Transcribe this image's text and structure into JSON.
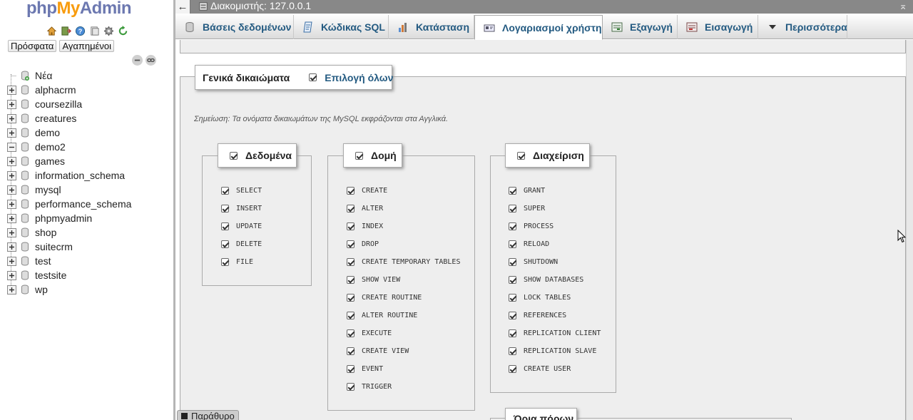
{
  "logo": {
    "php": "php",
    "my": "My",
    "admin": "Admin"
  },
  "nav": {
    "icons": [
      "home-icon",
      "exit-icon",
      "help-icon",
      "docs-icon",
      "settings-icon",
      "reload-icon"
    ],
    "tabs": [
      "Πρόσφατα",
      "Αγαπημένοι"
    ],
    "tree": [
      {
        "label": "Νέα",
        "type": "new"
      },
      {
        "label": "alphacrm",
        "type": "plus"
      },
      {
        "label": "coursezilla",
        "type": "plus"
      },
      {
        "label": "creatures",
        "type": "plus"
      },
      {
        "label": "demo",
        "type": "plus"
      },
      {
        "label": "demo2",
        "type": "minus"
      },
      {
        "label": "games",
        "type": "plus"
      },
      {
        "label": "information_schema",
        "type": "plus"
      },
      {
        "label": "mysql",
        "type": "plus"
      },
      {
        "label": "performance_schema",
        "type": "plus"
      },
      {
        "label": "phpmyadmin",
        "type": "plus"
      },
      {
        "label": "shop",
        "type": "plus"
      },
      {
        "label": "suitecrm",
        "type": "plus"
      },
      {
        "label": "test",
        "type": "plus"
      },
      {
        "label": "testsite",
        "type": "plus"
      },
      {
        "label": "wp",
        "type": "plus"
      }
    ]
  },
  "topbar": {
    "back": "←",
    "server": "Διακομιστής: 127.0.0.1",
    "collapse": "⌅"
  },
  "tabs": [
    {
      "label": "Βάσεις δεδομένων",
      "icon": "database-icon",
      "active": false
    },
    {
      "label": "Κώδικας SQL",
      "icon": "sql-icon",
      "active": false
    },
    {
      "label": "Κατάσταση",
      "icon": "status-icon",
      "active": false
    },
    {
      "label": "Λογαριασμοί χρήστη",
      "icon": "users-icon",
      "active": true
    },
    {
      "label": "Εξαγωγή",
      "icon": "export-icon",
      "active": false
    },
    {
      "label": "Εισαγωγή",
      "icon": "import-icon",
      "active": false
    },
    {
      "label": "Περισσότερα",
      "icon": "chevron-down-icon",
      "active": false
    }
  ],
  "privileges": {
    "legend_title": "Γενικά δικαιώματα",
    "select_all": "Επιλογή όλων",
    "note": "Σημείωση: Τα ονόματα δικαιωμάτων της MySQL εκφράζονται στα Αγγλικά.",
    "groups": [
      {
        "title": "Δεδομένα",
        "items": [
          "SELECT",
          "INSERT",
          "UPDATE",
          "DELETE",
          "FILE"
        ]
      },
      {
        "title": "Δομή",
        "items": [
          "CREATE",
          "ALTER",
          "INDEX",
          "DROP",
          "CREATE TEMPORARY TABLES",
          "SHOW VIEW",
          "CREATE ROUTINE",
          "ALTER ROUTINE",
          "EXECUTE",
          "CREATE VIEW",
          "EVENT",
          "TRIGGER"
        ]
      },
      {
        "title": "Διαχείριση",
        "items": [
          "GRANT",
          "SUPER",
          "PROCESS",
          "RELOAD",
          "SHUTDOWN",
          "SHOW DATABASES",
          "LOCK TABLES",
          "REFERENCES",
          "REPLICATION CLIENT",
          "REPLICATION SLAVE",
          "CREATE USER"
        ]
      }
    ],
    "resource_limits": "Όρια πόρων"
  },
  "console": {
    "label": "Παράθυρο"
  }
}
